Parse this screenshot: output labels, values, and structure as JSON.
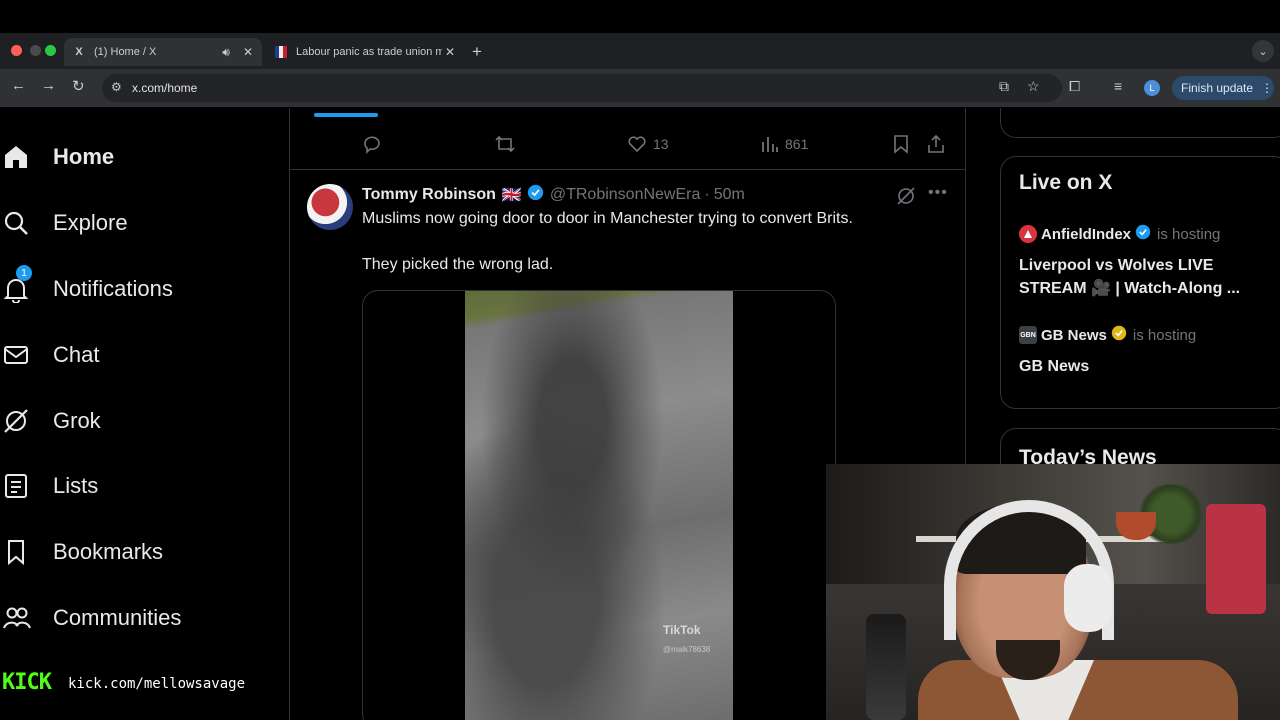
{
  "browser": {
    "tabs": [
      {
        "title": "(1) Home / X",
        "active": true,
        "favicon": "X"
      },
      {
        "title": "Labour panic as trade union m",
        "active": false
      }
    ],
    "url": "x.com/home",
    "profile_initial": "L",
    "finish_update_label": "Finish update"
  },
  "nav": {
    "items": [
      {
        "label": "Home",
        "icon": "home-icon"
      },
      {
        "label": "Explore",
        "icon": "search-icon"
      },
      {
        "label": "Notifications",
        "icon": "bell-icon",
        "badge": "1"
      },
      {
        "label": "Chat",
        "icon": "mail-icon"
      },
      {
        "label": "Grok",
        "icon": "grok-icon"
      },
      {
        "label": "Lists",
        "icon": "list-icon"
      },
      {
        "label": "Bookmarks",
        "icon": "bookmark-icon"
      },
      {
        "label": "Communities",
        "icon": "people-icon"
      }
    ]
  },
  "prev_tweet_actions": {
    "likes": "13",
    "views": "861"
  },
  "tweet": {
    "name": "Tommy Robinson",
    "flag": "🇬🇧",
    "handle": "@TRobinsonNewEra",
    "separator": "·",
    "time": "50m",
    "line1": "Muslims now going door to door in Manchester trying to convert Brits.",
    "line2": "They picked the wrong lad.",
    "tiktok_brand": "TikTok",
    "tiktok_user": "@maik78638"
  },
  "live": {
    "title": "Live on X",
    "hosting_label": "is hosting",
    "hosts": [
      {
        "name": "AnfieldIndex",
        "badge": "blue",
        "title_line1": "Liverpool vs Wolves LIVE",
        "title_line2": "STREAM 🎥 | Watch-Along ..."
      },
      {
        "name": "GB News",
        "badge": "gold",
        "avatar_text": "GBN",
        "title_line1": "GB News"
      }
    ]
  },
  "news": {
    "title": "Today’s News"
  },
  "stream": {
    "logo": "KICK",
    "url": "kick.com/mellowsavage"
  },
  "colors": {
    "accent": "#1d9bf0",
    "kick_green": "#53fc18",
    "background": "#000000",
    "muted": "#71767b"
  }
}
